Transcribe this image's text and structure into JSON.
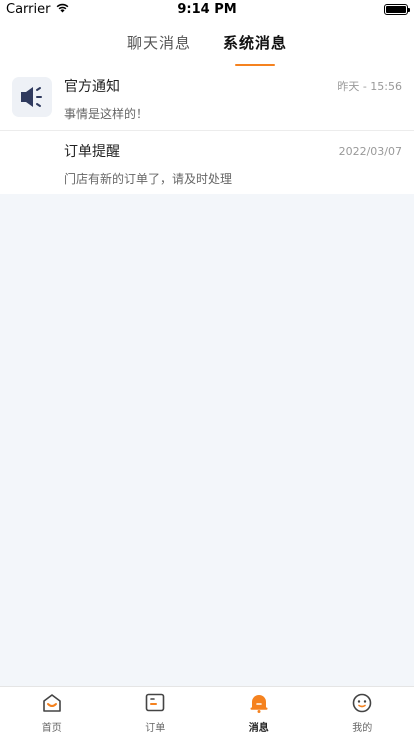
{
  "status_bar": {
    "carrier": "Carrier",
    "time": "9:14 PM"
  },
  "tabs": [
    {
      "label": "聊天消息",
      "active": false
    },
    {
      "label": "系统消息",
      "active": true
    }
  ],
  "messages": [
    {
      "title": "官方通知",
      "time": "昨天 - 15:56",
      "preview": "事情是这样的！",
      "icon": "speaker-icon"
    },
    {
      "title": "订单提醒",
      "time": "2022/03/07",
      "preview": "门店有新的订单了，请及时处理",
      "icon": ""
    }
  ],
  "bottom_nav": [
    {
      "label": "首页",
      "icon": "home-icon"
    },
    {
      "label": "订单",
      "icon": "order-icon"
    },
    {
      "label": "消息",
      "icon": "bell-icon",
      "active": true
    },
    {
      "label": "我的",
      "icon": "profile-icon"
    }
  ],
  "colors": {
    "accent": "#f5821f",
    "icon_dark": "#2f3a5e",
    "background": "#f3f6fa"
  }
}
